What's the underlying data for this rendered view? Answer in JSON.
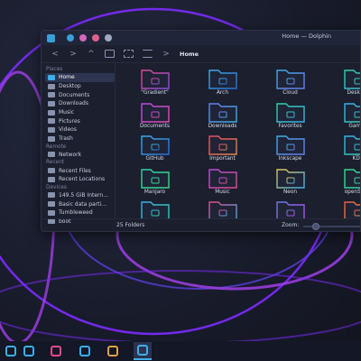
{
  "window": {
    "title": "Home — Dolphin"
  },
  "titlebar": {
    "dots": [
      "#3a9fd8",
      "#d16ab8",
      "#e0608c",
      "#a0a8c0"
    ]
  },
  "toolbar": {
    "back": "<",
    "forward": ">",
    "up": "^",
    "crumb_sep": ">",
    "breadcrumb": "Home"
  },
  "sidebar": {
    "places_label": "Places",
    "places": [
      {
        "label": "Home",
        "icon": "home-icon",
        "color": "#3daee9",
        "active": true
      },
      {
        "label": "Desktop",
        "icon": "desktop-icon",
        "color": "#8a92ad"
      },
      {
        "label": "Documents",
        "icon": "documents-icon",
        "color": "#8a92ad"
      },
      {
        "label": "Downloads",
        "icon": "downloads-icon",
        "color": "#8a92ad"
      },
      {
        "label": "Music",
        "icon": "music-icon",
        "color": "#8a92ad"
      },
      {
        "label": "Pictures",
        "icon": "pictures-icon",
        "color": "#8a92ad"
      },
      {
        "label": "Videos",
        "icon": "videos-icon",
        "color": "#8a92ad"
      },
      {
        "label": "Trash",
        "icon": "trash-icon",
        "color": "#8a92ad"
      }
    ],
    "remote_label": "Remote",
    "remote": [
      {
        "label": "Network",
        "icon": "network-icon",
        "color": "#8a92ad"
      }
    ],
    "recent_label": "Recent",
    "recent": [
      {
        "label": "Recent Files",
        "icon": "recent-files-icon",
        "color": "#8a92ad"
      },
      {
        "label": "Recent Locations",
        "icon": "recent-locations-icon",
        "color": "#8a92ad"
      }
    ],
    "devices_label": "Devices",
    "devices": [
      {
        "label": "149.5 GiB Intern...",
        "icon": "drive-icon",
        "color": "#8a92ad"
      },
      {
        "label": "Basic data parti...",
        "icon": "drive-icon",
        "color": "#8a92ad"
      },
      {
        "label": "Tumbleweed",
        "icon": "drive-icon",
        "color": "#8a92ad"
      },
      {
        "label": "boot",
        "icon": "drive-icon",
        "color": "#8a92ad"
      }
    ]
  },
  "folders": [
    {
      "label": "\"Gradient\"",
      "icon": "gradient-folder-icon",
      "c1": "#e04b8a",
      "c2": "#8a4be0"
    },
    {
      "label": "Arch",
      "icon": "arch-folder-icon",
      "c1": "#3daee9",
      "c2": "#2a6fd6"
    },
    {
      "label": "Cloud",
      "icon": "cloud-folder-icon",
      "c1": "#3daee9",
      "c2": "#6a7be8"
    },
    {
      "label": "Desktop",
      "icon": "desktop-folder-icon",
      "c1": "#2ed3a6",
      "c2": "#3daee9"
    },
    {
      "label": "Documents",
      "icon": "documents-folder-icon",
      "c1": "#b84be0",
      "c2": "#e04bb0"
    },
    {
      "label": "Downloads",
      "icon": "downloads-folder-icon",
      "c1": "#6a7be8",
      "c2": "#3daee9"
    },
    {
      "label": "Favorites",
      "icon": "favorites-folder-icon",
      "c1": "#2ed3a6",
      "c2": "#3daee9"
    },
    {
      "label": "Games",
      "icon": "games-folder-icon",
      "c1": "#3daee9",
      "c2": "#2ed3a6"
    },
    {
      "label": "GitHub",
      "icon": "github-folder-icon",
      "c1": "#3daee9",
      "c2": "#2a6fd6"
    },
    {
      "label": "Important",
      "icon": "important-folder-icon",
      "c1": "#e04b6a",
      "c2": "#e08a4b"
    },
    {
      "label": "Inkscape",
      "icon": "inkscape-folder-icon",
      "c1": "#3daee9",
      "c2": "#6a7be8"
    },
    {
      "label": "KDE",
      "icon": "kde-folder-icon",
      "c1": "#3daee9",
      "c2": "#2ed3a6"
    },
    {
      "label": "Manjaro",
      "icon": "manjaro-folder-icon",
      "c1": "#2ed3a6",
      "c2": "#3dd68a"
    },
    {
      "label": "Music",
      "icon": "music-folder-icon",
      "c1": "#b84be0",
      "c2": "#e04b8a"
    },
    {
      "label": "Neon",
      "icon": "neon-folder-icon",
      "c1": "#e0c84b",
      "c2": "#3daee9"
    },
    {
      "label": "openSUSE",
      "icon": "opensuse-folder-icon",
      "c1": "#3dd68a",
      "c2": "#2ed3a6"
    },
    {
      "label": "Plasma",
      "icon": "plasma-folder-icon",
      "c1": "#3daee9",
      "c2": "#2ed3a6"
    },
    {
      "label": "Pop!_OS",
      "icon": "popos-folder-icon",
      "c1": "#e04b8a",
      "c2": "#3daee9"
    },
    {
      "label": "Projects",
      "icon": "projects-folder-icon",
      "c1": "#6a7be8",
      "c2": "#b84be0"
    },
    {
      "label": "Reddit",
      "icon": "reddit-folder-icon",
      "c1": "#e0604b",
      "c2": "#e0a04b"
    }
  ],
  "status": {
    "count": "25 Folders",
    "zoom_label": "Zoom:"
  },
  "taskbar": [
    {
      "icon": "app-launcher-icon",
      "color": "#3daee9",
      "active": false
    },
    {
      "icon": "discover-icon",
      "color": "#3daee9",
      "active": false
    },
    {
      "icon": "konsole-icon",
      "color": "#e04b8a",
      "active": false
    },
    {
      "icon": "settings-icon",
      "color": "#3daee9",
      "active": false
    },
    {
      "icon": "firefox-icon",
      "color": "#e0a04b",
      "active": false
    },
    {
      "icon": "dolphin-icon",
      "color": "#3daee9",
      "active": true
    }
  ],
  "colors": {
    "accent": "#3daee9",
    "neon_purple": "#9b3dff",
    "neon_blue": "#5a6cff"
  }
}
